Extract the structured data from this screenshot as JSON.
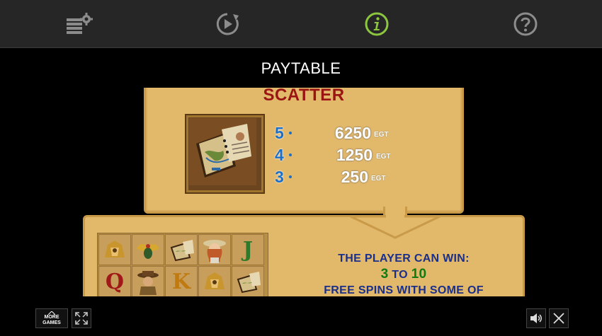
{
  "toolbar": {
    "icons": [
      "paytable-settings-icon",
      "replay-icon",
      "info-icon",
      "help-icon"
    ],
    "active_color": "#8cc63f",
    "icon_color": "#8c8c8c"
  },
  "page": {
    "title": "PAYTABLE"
  },
  "scatter": {
    "heading": "SCATTER",
    "symbol": "journal-map-icon",
    "payouts": [
      {
        "count": "5",
        "value": "6250",
        "currency": "EGT"
      },
      {
        "count": "4",
        "value": "1250",
        "currency": "EGT"
      },
      {
        "count": "3",
        "value": "250",
        "currency": "EGT"
      }
    ]
  },
  "free_spins": {
    "line1": "THE PLAYER CAN WIN:",
    "min": "3",
    "to": "TO",
    "max": "10",
    "line3": "FREE SPINS WITH SOME OF"
  },
  "reels": {
    "row1": [
      "sphinx-icon",
      "scarab-icon",
      "journal-icon",
      "explorer-woman-icon",
      "J"
    ],
    "row2": [
      "Q",
      "explorer-man-icon",
      "K",
      "sphinx-icon",
      "journal-icon"
    ]
  },
  "footer": {
    "more_games_line1": "MORE",
    "more_games_line2": "GAMES",
    "fullscreen_icon": "fullscreen-icon",
    "sound_icon": "speaker-icon",
    "close_icon": "close-icon"
  }
}
